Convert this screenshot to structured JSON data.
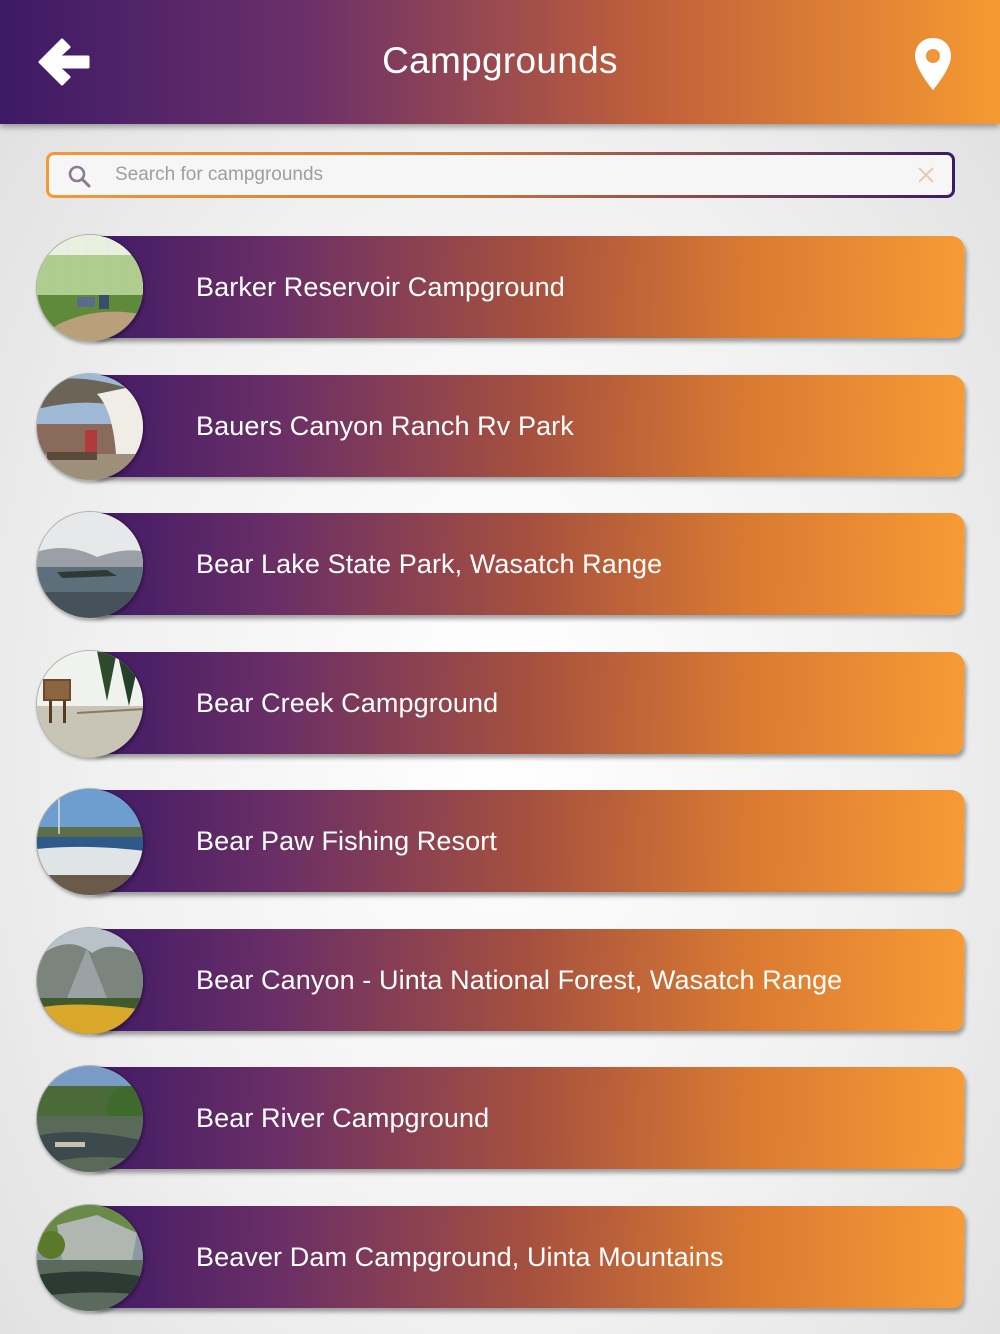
{
  "header": {
    "title": "Campgrounds",
    "back_icon": "arrow-left-icon",
    "map_icon": "map-pin-icon"
  },
  "search": {
    "placeholder": "Search for campgrounds",
    "value": ""
  },
  "colors": {
    "gradient_start": "#3d1a66",
    "gradient_end": "#f79b35",
    "text": "#ffffff"
  },
  "campgrounds": [
    {
      "name": "Barker Reservoir Campground"
    },
    {
      "name": "Bauers Canyon Ranch Rv Park"
    },
    {
      "name": "Bear Lake State Park, Wasatch Range"
    },
    {
      "name": "Bear Creek Campground"
    },
    {
      "name": "Bear Paw Fishing Resort"
    },
    {
      "name": "Bear Canyon - Uinta National Forest, Wasatch Range"
    },
    {
      "name": "Bear River Campground"
    },
    {
      "name": "Beaver Dam Campground, Uinta Mountains"
    }
  ]
}
